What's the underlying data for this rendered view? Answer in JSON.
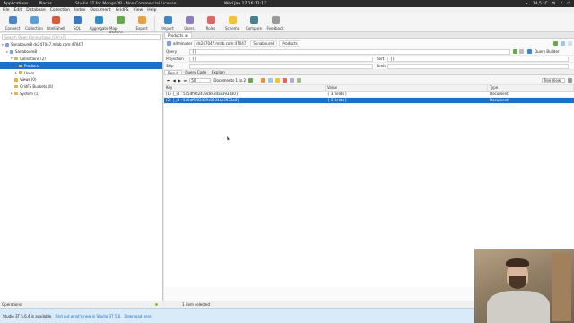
{
  "system_bar": {
    "applications": "Applications",
    "places": "Places",
    "app_title": "Studio 3T for MongoDB - Non-Commercial License",
    "clock": "Wed Jan 17 16:11:17",
    "temperature": "14,5 °C"
  },
  "menu": [
    "File",
    "Edit",
    "Database",
    "Collection",
    "Index",
    "Document",
    "GridFS",
    "View",
    "Help"
  ],
  "toolbar": [
    {
      "label": "Connect",
      "color": "#4a86c8"
    },
    {
      "label": "Collection",
      "color": "#5aa0d8"
    },
    {
      "label": "IntelliShell",
      "color": "#d95c3a"
    },
    {
      "label": "SQL",
      "color": "#3c78c0"
    },
    {
      "label": "Aggregate",
      "color": "#2e8fc6"
    },
    {
      "label": "Map-Reduce",
      "color": "#6aa84f"
    },
    {
      "label": "Export",
      "color": "#e6a23c"
    },
    {
      "label": "Import",
      "color": "#3d85c6"
    },
    {
      "label": "Users",
      "color": "#8e7cc3"
    },
    {
      "label": "Roles",
      "color": "#e06666"
    },
    {
      "label": "Schema",
      "color": "#f1c232"
    },
    {
      "label": "Compare",
      "color": "#45818e"
    },
    {
      "label": "Feedback",
      "color": "#999999"
    }
  ],
  "left": {
    "search_placeholder": "Search Open Connections (Ctrl+F) ...",
    "tree": [
      {
        "label": "Sanaboure8 ds247047.mlab.com:47047",
        "indent": 0,
        "type": "db",
        "arrow": "▾"
      },
      {
        "label": "Sanaboure8",
        "indent": 1,
        "type": "db",
        "arrow": "▾"
      },
      {
        "label": "Collections (2)",
        "indent": 2,
        "type": "folder",
        "arrow": "▾"
      },
      {
        "label": "Products",
        "indent": 3,
        "type": "folder",
        "arrow": "▸",
        "selected": true
      },
      {
        "label": "Users",
        "indent": 3,
        "type": "folder",
        "arrow": "▸"
      },
      {
        "label": "Views (0)",
        "indent": 2,
        "type": "folder",
        "arrow": ""
      },
      {
        "label": "GridFS Buckets (0)",
        "indent": 2,
        "type": "folder",
        "arrow": ""
      },
      {
        "label": "System (1)",
        "indent": 2,
        "type": "folder",
        "arrow": "▸"
      }
    ],
    "operations": "Operations"
  },
  "right": {
    "tab_label": "Products",
    "breadcrumb": [
      "adminuser",
      "ds247047.mlab.com:47047",
      "Sanaboure8",
      "Products"
    ],
    "query_builder": "Query Builder",
    "query": {
      "label": "Query",
      "value": "{}"
    },
    "projection": {
      "label": "Projection",
      "value": "{}"
    },
    "sort": {
      "label": "Sort",
      "value": "{}"
    },
    "skip": {
      "label": "Skip",
      "value": ""
    },
    "limit": {
      "label": "Limit",
      "value": ""
    },
    "result_tabs": [
      "Result",
      "Query Code",
      "Explain"
    ],
    "page_size": "50",
    "documents_range": "Documents 1 to 2",
    "view_mode": "Tree View",
    "columns": {
      "key": "Key",
      "value": "Value",
      "type": "Type"
    },
    "rows": [
      {
        "key": "(1) {_id : 5a5df9d2439c8934ac3933a0}",
        "value": "{ 3 fields }",
        "type": "Document",
        "selected": false
      },
      {
        "key": "(2) {_id : 5a5df9f03439c8934ac3933a0}",
        "value": "{ 3 fields }",
        "type": "Document",
        "selected": true
      }
    ]
  },
  "status": {
    "selected": "1 item selected"
  },
  "bottom": {
    "notice": "Studio 3T 5.6.4 is available.",
    "whats_new": "Find out what's new in Studio 3T 5.6.",
    "download": "Download here."
  }
}
